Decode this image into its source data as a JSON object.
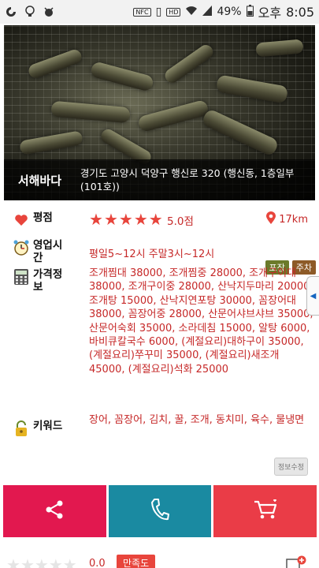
{
  "statusbar": {
    "left_icons": [
      "app-icon",
      "lightbulb-icon",
      "bug-icon"
    ],
    "nfc": "NFC",
    "hd": "HD",
    "battery": "49%",
    "ampm": "오후",
    "time": "8:05"
  },
  "shop": {
    "name": "서해바다",
    "address": "경기도 고양시 덕양구 행신로 320 (행신동, 1층일부(101호))"
  },
  "rating": {
    "label": "평점",
    "stars": 5,
    "score": "5.0점",
    "distance": "17km"
  },
  "hours": {
    "label": "영업시간",
    "value": "평일5~12시 주말3시~12시"
  },
  "price": {
    "label": "가격정보",
    "tags": [
      "포장",
      "주차"
    ],
    "value": "조개찜대 38000, 조개찜중 28000, 조개구이대 38000, 조개구이중 28000, 산낙지두마리 20000, 조개탕 15000, 산낙지연포탕 30000, 꼼장어대 38000, 꼼장어중 28000, 산문어샤브샤브 35000, 산문어숙회 35000, 소라데침 15000, 알탕 6000, 바비큐칼국수 6000, (계절요리)대하구이 35000, (계절요리)쭈꾸미 35000, (계절요리)새조개 45000, (계절요리)석화 25000"
  },
  "keywords": {
    "label": "키워드",
    "value": "장어, 꼼장어, 김치, 꿀, 조개, 동치미, 육수, 물냉면"
  },
  "edit_label": "정보수정",
  "actions": {
    "share": "share-icon",
    "call": "phone-icon",
    "cart": "cart-icon"
  },
  "my_rating": {
    "score": "0.0",
    "button": "만족도"
  },
  "colors": {
    "accent_red": "#c62828",
    "share_bg": "#e2184f",
    "call_bg": "#1a8aa1",
    "cart_bg": "#ea3c47"
  }
}
